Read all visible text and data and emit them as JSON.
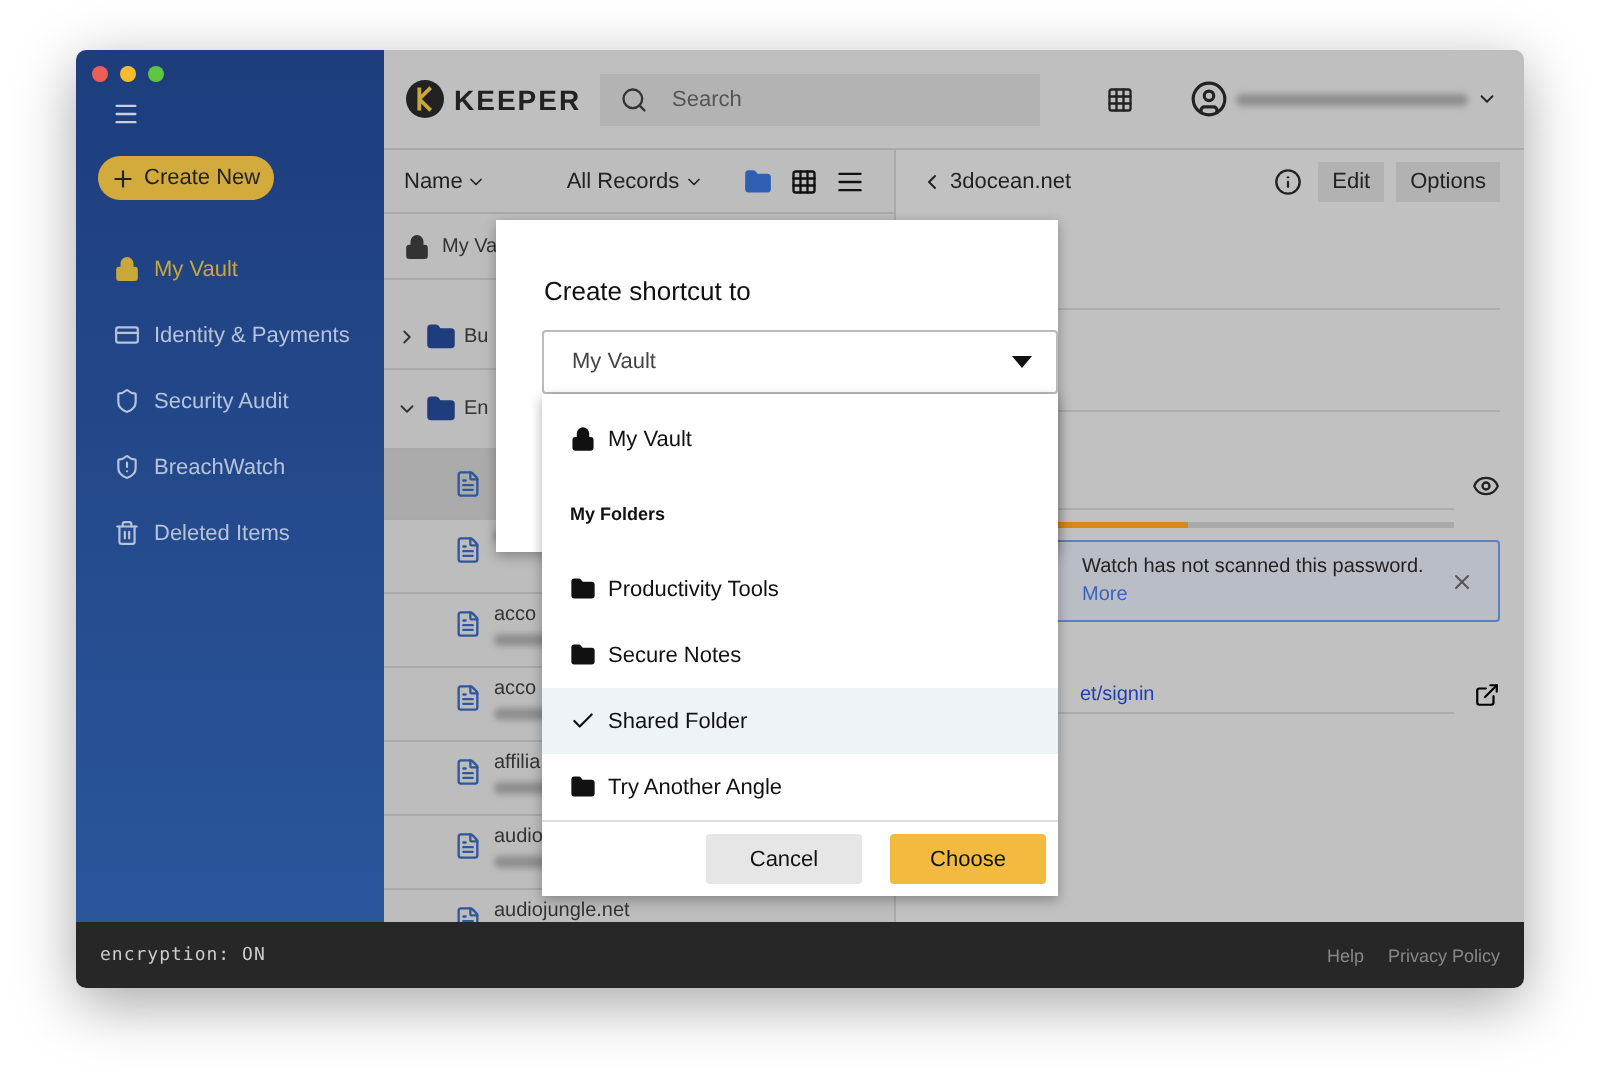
{
  "sidebar": {
    "create_button": "Create New",
    "items": [
      {
        "kind": "vault",
        "label": "My Vault",
        "selected": true
      },
      {
        "kind": "card",
        "label": "Identity & Payments",
        "selected": false
      },
      {
        "kind": "audit",
        "label": "Security Audit",
        "selected": false
      },
      {
        "kind": "breach",
        "label": "BreachWatch",
        "selected": false
      },
      {
        "kind": "trash",
        "label": "Deleted Items",
        "selected": false
      }
    ]
  },
  "topbar": {
    "logo": "KEEPER",
    "search": {
      "placeholder": "Search"
    }
  },
  "list_toolbar": {
    "sort": "Name",
    "filter": "All Records",
    "views": [
      {
        "kind": "folder",
        "selected": true
      },
      {
        "kind": "grid",
        "selected": false
      },
      {
        "kind": "list",
        "selected": false
      }
    ]
  },
  "list": {
    "vault_row": "My Va",
    "folders": [
      {
        "label": "Bu",
        "expanded": false
      },
      {
        "label": "En",
        "expanded": true
      }
    ],
    "records": [
      {
        "selected": true
      },
      {
        "selected": false
      },
      {
        "title": "acco",
        "selected": false
      },
      {
        "title": "acco",
        "selected": false
      },
      {
        "title": "affilia",
        "selected": false
      },
      {
        "title": "audio",
        "selected": false
      },
      {
        "title": "audiojungle.net",
        "selected": false
      }
    ]
  },
  "detail": {
    "title": "3docean.net",
    "buttons": [
      "Edit",
      "Options"
    ],
    "strength": {
      "level": 0.5
    },
    "notice": {
      "text": "Watch has not scanned this password.",
      "link": "More"
    },
    "url": "et/signin"
  },
  "dialog": {
    "title": "Create shortcut to",
    "select": {
      "value": "My Vault"
    },
    "options": [
      {
        "kind": "vault",
        "label": "My Vault",
        "selected": false
      },
      {
        "kind": "header",
        "label": "My Folders"
      },
      {
        "kind": "folder",
        "label": "Productivity Tools",
        "selected": false
      },
      {
        "kind": "folder",
        "label": "Secure Notes",
        "selected": false
      },
      {
        "kind": "folder",
        "label": "Shared Folder",
        "selected": true
      },
      {
        "kind": "folder",
        "label": "Try Another Angle",
        "selected": false
      }
    ],
    "buttons": [
      {
        "kind": "secondary",
        "label": "Cancel"
      },
      {
        "kind": "primary",
        "label": "Choose"
      }
    ]
  },
  "footer": {
    "status": "encryption: ON",
    "links": [
      "Help",
      "Privacy Policy"
    ]
  }
}
